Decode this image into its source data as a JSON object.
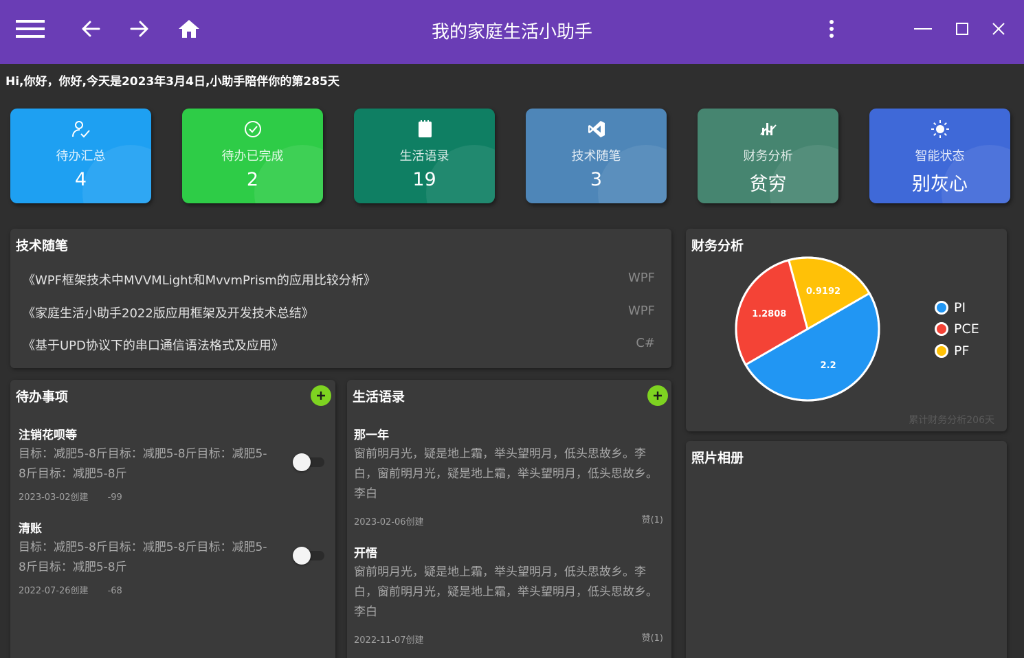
{
  "window": {
    "title": "我的家庭生活小助手",
    "menu_icon": "hamburger-menu-icon",
    "back_icon": "arrow-left-icon",
    "forward_icon": "arrow-right-icon",
    "home_icon": "home-icon",
    "more_icon": "more-vertical-icon",
    "minimize_icon": "minimize-icon",
    "maximize_icon": "maximize-icon",
    "close_icon": "close-icon",
    "bar_color": "#6a3db5"
  },
  "greeting": "Hi,你好，你好,今天是2023年3月4日,小助手陪伴你的第285天",
  "cards": [
    {
      "label": "待办汇总",
      "value": "4",
      "icon": "user-check-icon",
      "color": "#1ea0f2"
    },
    {
      "label": "待办已完成",
      "value": "2",
      "icon": "check-circle-icon",
      "color": "#2ecc47"
    },
    {
      "label": "生活语录",
      "value": "19",
      "icon": "notebook-icon",
      "color": "#0f7f63"
    },
    {
      "label": "技术随笔",
      "value": "3",
      "icon": "visual-studio-icon",
      "color": "#4e86b8"
    },
    {
      "label": "财务分析",
      "value": "贫穷",
      "icon": "bar-chart-icon",
      "color": "#468570"
    },
    {
      "label": "智能状态",
      "value": "别灰心",
      "icon": "sun-icon",
      "color": "#3f69d8"
    }
  ],
  "tech": {
    "title": "技术随笔",
    "items": [
      {
        "title": "《WPF框架技术中MVVMLight和MvvmPrism的应用比较分析》",
        "tag": "WPF"
      },
      {
        "title": "《家庭生活小助手2022版应用框架及开发技术总结》",
        "tag": "WPF"
      },
      {
        "title": "《基于UPD协议下的串口通信语法格式及应用》",
        "tag": "C#"
      }
    ]
  },
  "todo": {
    "title": "待办事项",
    "add_icon": "plus-icon",
    "items": [
      {
        "title": "注销花呗等",
        "desc": "目标：减肥5-8斤目标：减肥5-8斤目标：减肥5-8斤目标：减肥5-8斤",
        "date": "2023-03-02创建",
        "days": "-99",
        "done": false
      },
      {
        "title": "清账",
        "desc": "目标：减肥5-8斤目标：减肥5-8斤目标：减肥5-8斤目标：减肥5-8斤",
        "date": "2022-07-26创建",
        "days": "-68",
        "done": false
      }
    ]
  },
  "life": {
    "title": "生活语录",
    "add_icon": "plus-icon",
    "items": [
      {
        "title": "那一年",
        "text": "窗前明月光，疑是地上霜，举头望明月，低头思故乡。李白，窗前明月光，疑是地上霜，举头望明月，低头思故乡。李白",
        "date": "2023-02-06创建",
        "likes": "赞(1)"
      },
      {
        "title": "开悟",
        "text": "窗前明月光，疑是地上霜，举头望明月，低头思故乡。李白，窗前明月光，疑是地上霜，举头望明月，低头思故乡。李白",
        "date": "2022-11-07创建",
        "likes": "赞(1)"
      }
    ]
  },
  "finance": {
    "title": "财务分析",
    "footer": "累计财务分析206天"
  },
  "photos": {
    "title": "照片相册"
  },
  "chart_data": {
    "type": "pie",
    "categories": [
      "PI",
      "PCE",
      "PF"
    ],
    "values": [
      2.2,
      1.2808,
      0.9192
    ],
    "labels": [
      "2.2",
      "1.2808",
      "0.9192"
    ],
    "colors": [
      "#2196f3",
      "#f44336",
      "#ffc107"
    ],
    "legend": "right"
  }
}
